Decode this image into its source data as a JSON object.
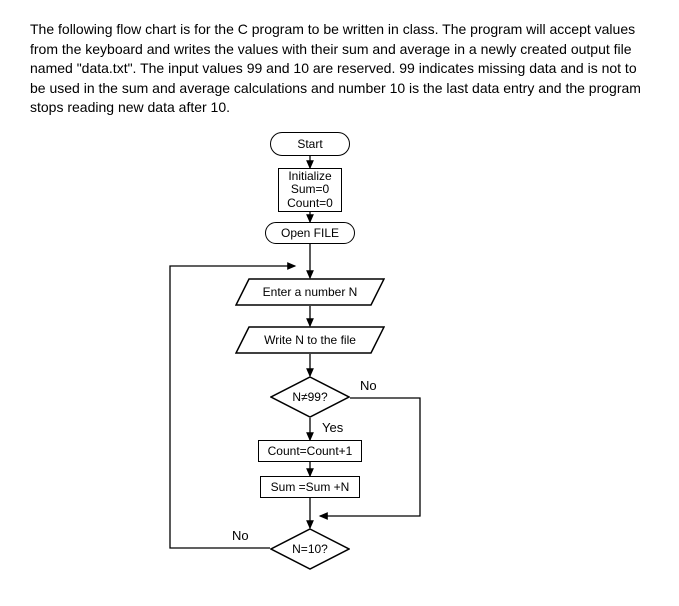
{
  "description": "The following flow chart is for the C program to be written in class. The program will accept values from the keyboard and writes the values with their sum and average in a newly created output file named \"data.txt\". The input values 99 and 10 are reserved. 99 indicates missing data and is not to be used in the sum and average calculations and number 10 is the last data entry and the program stops reading new data after 10.",
  "flow": {
    "start": "Start",
    "init_title": "Initialize",
    "init_sum": "Sum=0",
    "init_count": "Count=0",
    "open_file": "Open FILE",
    "enter_n": "Enter a number N",
    "write_n": "Write N to the file",
    "check99": "N≠99?",
    "check99_no": "No",
    "check99_yes": "Yes",
    "count_inc": "Count=Count+1",
    "sum_inc": "Sum =Sum +N",
    "check10": "N=10?",
    "check10_no": "No"
  },
  "chart_data": {
    "type": "flowchart",
    "nodes": [
      {
        "id": "start",
        "shape": "terminator",
        "text": "Start"
      },
      {
        "id": "init",
        "shape": "process",
        "text": "Initialize\nSum=0\nCount=0"
      },
      {
        "id": "open",
        "shape": "subprocess",
        "text": "Open FILE"
      },
      {
        "id": "enter",
        "shape": "io",
        "text": "Enter a number N"
      },
      {
        "id": "write",
        "shape": "io",
        "text": "Write N to the file"
      },
      {
        "id": "d99",
        "shape": "decision",
        "text": "N≠99?"
      },
      {
        "id": "count",
        "shape": "process",
        "text": "Count=Count+1"
      },
      {
        "id": "sum",
        "shape": "process",
        "text": "Sum =Sum +N"
      },
      {
        "id": "d10",
        "shape": "decision",
        "text": "N=10?"
      }
    ],
    "edges": [
      {
        "from": "start",
        "to": "init"
      },
      {
        "from": "init",
        "to": "open"
      },
      {
        "from": "open",
        "to": "enter"
      },
      {
        "from": "enter",
        "to": "write"
      },
      {
        "from": "write",
        "to": "d99"
      },
      {
        "from": "d99",
        "to": "count",
        "label": "Yes"
      },
      {
        "from": "d99",
        "to": "sum_merge",
        "label": "No",
        "note": "skip to after sum"
      },
      {
        "from": "count",
        "to": "sum"
      },
      {
        "from": "sum",
        "to": "d10"
      },
      {
        "from": "d10",
        "to": "enter",
        "label": "No",
        "note": "loop back"
      }
    ]
  }
}
